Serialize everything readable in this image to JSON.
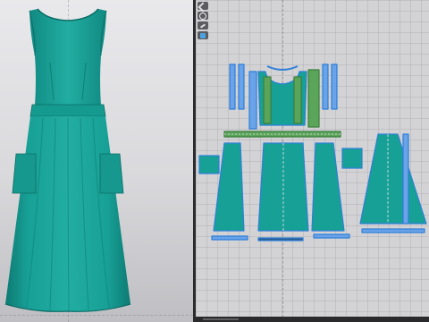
{
  "app": {
    "left_view": "3d-avatar-viewport",
    "right_view": "2d-pattern-window"
  },
  "colors": {
    "fabric": "#17a096",
    "fabric_shadow": "#0f7f77",
    "fabric_highlight": "#2ab7ac",
    "selected_outline": "#2f7fd8",
    "internal_line": "#5aa55a",
    "seam_dash": "#e8e8e8",
    "viewport_bg": "#e4e4e7",
    "pattern_bg": "#d3d3d6"
  },
  "toolbar": {
    "tools": [
      {
        "icon": "move-icon"
      },
      {
        "icon": "select-icon"
      },
      {
        "icon": "edit-pattern-icon"
      },
      {
        "icon": "add-point-icon"
      }
    ]
  },
  "garment": {
    "type": "sleeveless midi dress with waistband and patch pockets"
  }
}
